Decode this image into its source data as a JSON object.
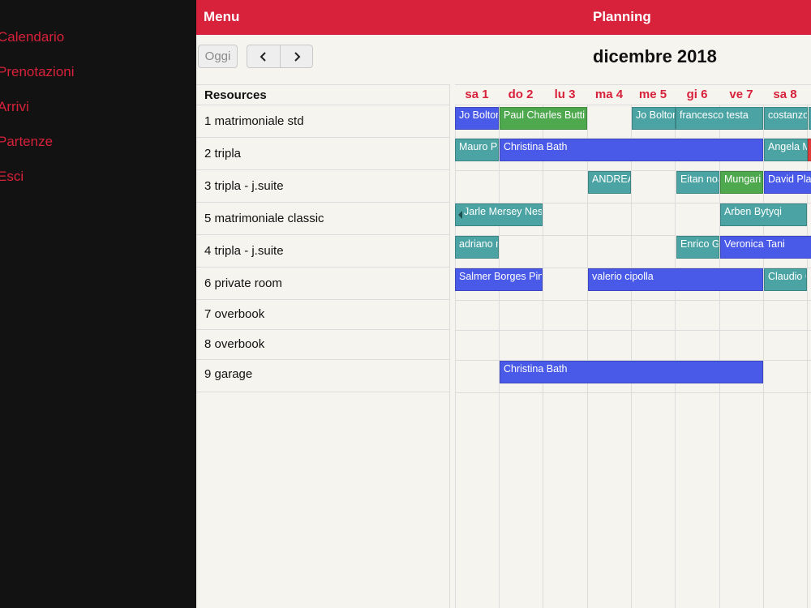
{
  "sidebar": {
    "items": [
      {
        "label": "Calendario"
      },
      {
        "label": "Prenotazioni"
      },
      {
        "label": "Arrivi"
      },
      {
        "label": "Partenze"
      },
      {
        "label": "Esci"
      }
    ]
  },
  "topbar": {
    "menu_label": "Menu",
    "title": "Planning"
  },
  "toolbar": {
    "today_label": "Oggi",
    "prev_icon": "chevron-left-icon",
    "next_icon": "chevron-right-icon",
    "month_title": "dicembre 2018"
  },
  "grid": {
    "resources_header": "Resources",
    "resources": [
      "1 matrimoniale std",
      "2 tripla",
      "3 tripla - j.suite",
      "5 matrimoniale classic",
      "4 tripla - j.suite",
      "6 private room",
      "7 overbook",
      "8 overbook",
      "9 garage"
    ],
    "days": [
      "sa 1",
      "do 2",
      "lu 3",
      "ma 4",
      "me 5",
      "gi 6",
      "ve 7",
      "sa 8"
    ],
    "events": [
      {
        "label": "Jo Bolton",
        "color": "#4a5ae8"
      },
      {
        "label": "Paul Charles Butti",
        "color": "#4ea84e"
      },
      {
        "label": "Jo Bolton",
        "color": "#4ba3a3"
      },
      {
        "label": "francesco testa",
        "color": "#4ba3a3"
      },
      {
        "label": "costanzo",
        "color": "#4ba3a3"
      },
      {
        "label": "",
        "color": "#4ba3a3"
      },
      {
        "label": "Mauro Pa",
        "color": "#4ba3a3"
      },
      {
        "label": "Christina Bath",
        "color": "#4a5ae8"
      },
      {
        "label": "Angela M",
        "color": "#4ba3a3"
      },
      {
        "label": "",
        "color": "#e23b3b"
      },
      {
        "label": "ANDREA",
        "color": "#4ba3a3"
      },
      {
        "label": "Eitan noa",
        "color": "#4ba3a3"
      },
      {
        "label": "Mungari",
        "color": "#4ea84e"
      },
      {
        "label": "David Pla",
        "color": "#4a5ae8"
      },
      {
        "label": "Jarle Mersey Ness",
        "color": "#4ba3a3"
      },
      {
        "label": "Arben Bytyqi",
        "color": "#4ba3a3"
      },
      {
        "label": "adriano r",
        "color": "#4ba3a3"
      },
      {
        "label": "Enrico G",
        "color": "#4ba3a3"
      },
      {
        "label": "Veronica Tani",
        "color": "#4a5ae8"
      },
      {
        "label": "Salmer Borges Pin",
        "color": "#4a5ae8"
      },
      {
        "label": "valerio cipolla",
        "color": "#4a5ae8"
      },
      {
        "label": "Claudio C",
        "color": "#4ba3a3"
      },
      {
        "label": "Christina Bath",
        "color": "#4a5ae8"
      }
    ]
  }
}
